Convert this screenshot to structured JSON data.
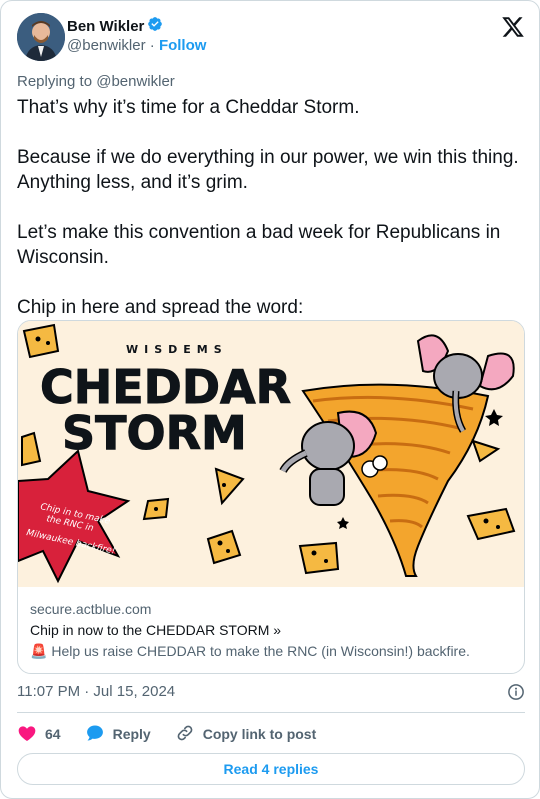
{
  "author": {
    "name": "Ben Wikler",
    "handle": "@benwikler",
    "separator": "·",
    "follow_label": "Follow",
    "verified": true
  },
  "replying_to": "Replying to @benwikler",
  "tweet": {
    "paragraphs": [
      "That’s why it’s time for a Cheddar Storm.",
      "Because if we do everything in our power, we win this thing. Anything less, and it’s grim.",
      "Let’s make this convention a bad week for Republicans in Wisconsin.",
      "Chip in here and spread the word:"
    ]
  },
  "link_card": {
    "banner": {
      "org": "WISDEMS",
      "headline_1": "CHEDDAR",
      "headline_2": "STORM",
      "burst_line_1": "Chip in to make",
      "burst_line_2": "the RNC in",
      "burst_line_3": "Milwaukee backfire!"
    },
    "domain": "secure.actblue.com",
    "title": "Chip in now to the CHEDDAR STORM »",
    "description_icon": "🚨",
    "description": "Help us raise CHEDDAR to make the RNC (in Wisconsin!) backfire."
  },
  "timestamp": "11:07 PM · Jul 15, 2024",
  "actions": {
    "likes": "64",
    "reply_label": "Reply",
    "copy_label": "Copy link to post"
  },
  "read_replies_label": "Read 4 replies",
  "colors": {
    "accent": "#1d9bf0",
    "like": "#f91880",
    "muted": "#536471",
    "text": "#0f1419",
    "banner_bg": "#fdf1de"
  }
}
